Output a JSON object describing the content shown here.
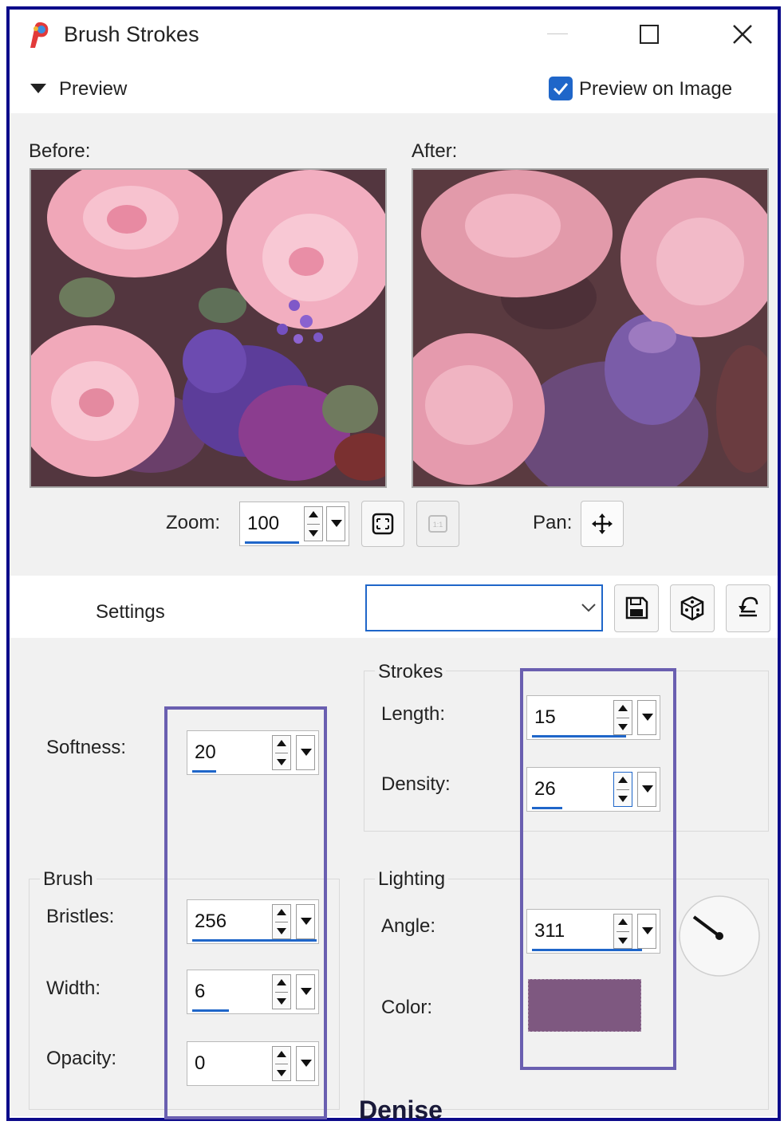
{
  "window": {
    "title": "Brush Strokes"
  },
  "preview": {
    "section_label": "Preview",
    "preview_on_image_label": "Preview on Image",
    "preview_on_image_checked": true,
    "before_label": "Before:",
    "after_label": "After:"
  },
  "zoom": {
    "label": "Zoom:",
    "value": "100",
    "pan_label": "Pan:"
  },
  "settings": {
    "label": "Settings",
    "preset_value": ""
  },
  "softness": {
    "label": "Softness:",
    "value": "20"
  },
  "brush": {
    "group_label": "Brush",
    "bristles": {
      "label": "Bristles:",
      "value": "256"
    },
    "width": {
      "label": "Width:",
      "value": "6"
    },
    "opacity": {
      "label": "Opacity:",
      "value": "0"
    }
  },
  "strokes": {
    "group_label": "Strokes",
    "length": {
      "label": "Length:",
      "value": "15"
    },
    "density": {
      "label": "Density:",
      "value": "26"
    }
  },
  "lighting": {
    "group_label": "Lighting",
    "angle": {
      "label": "Angle:",
      "value": "311"
    },
    "color": {
      "label": "Color:",
      "value": "#7e5880"
    }
  },
  "watermark": "Denise",
  "colors": {
    "frame": "#0c0a8a",
    "highlight": "#6a5fb0",
    "accent": "#1f66c9",
    "lighting_color": "#7e5880"
  }
}
